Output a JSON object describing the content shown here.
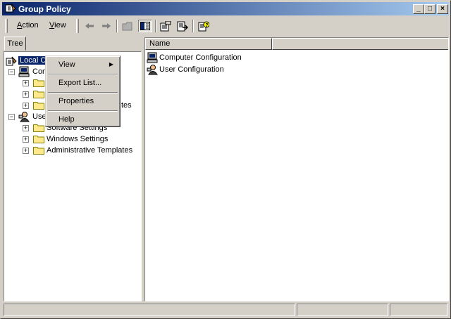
{
  "window": {
    "title": "Group Policy"
  },
  "menu": {
    "action_label": "Action",
    "action_underline": "A",
    "action_rest": "ction",
    "view_label": "View",
    "view_underline": "V",
    "view_rest": "iew"
  },
  "toolbar": {
    "icons": [
      "back-arrow-icon",
      "forward-arrow-icon",
      "up-folder-icon",
      "show-hide-tree-icon",
      "properties-icon",
      "export-list-icon",
      "help-icon"
    ]
  },
  "tree": {
    "tab_label": "Tree",
    "items": {
      "root": "Local Computer Policy",
      "computer_config": "Computer Configuration",
      "computer_software": "Software Settings",
      "computer_windows": "Windows Settings",
      "computer_admin": "Administrative Templates",
      "user_config": "User Configuration",
      "user_software": "Software Settings",
      "user_windows": "Windows Settings",
      "user_admin": "Administrative Templates"
    },
    "visible": {
      "root": "Local C",
      "computer_config": "Com",
      "computer_admin_tail": "tes",
      "user_config": "Use",
      "user_software_tail": "Software Settings"
    }
  },
  "list": {
    "header": "Name",
    "rows": [
      "Computer Configuration",
      "User Configuration"
    ]
  },
  "context_menu": {
    "items": [
      "View",
      "Export List...",
      "Properties",
      "Help"
    ]
  },
  "colors": {
    "title_start": "#0a246a",
    "title_end": "#a6caf0",
    "face": "#d4d0c8",
    "selection": "#0a246a"
  }
}
